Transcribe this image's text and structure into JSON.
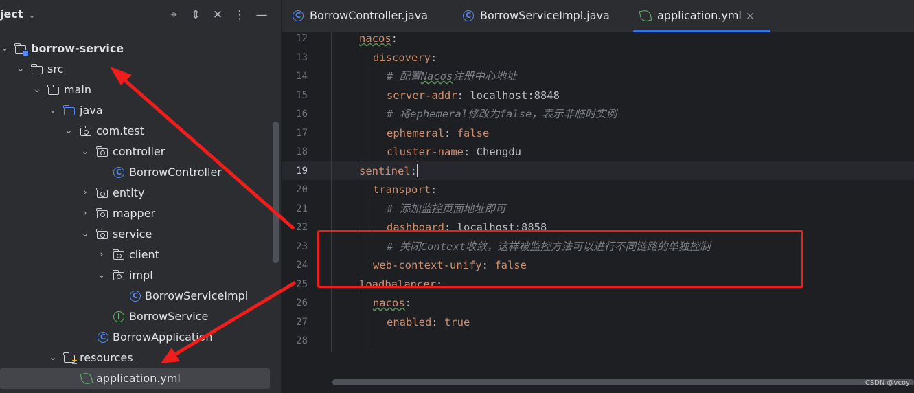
{
  "project_panel": {
    "title": "ject",
    "tree": [
      {
        "label": "borrow-service",
        "icon": "module-folder-icon",
        "expanded": true,
        "bold": true
      },
      {
        "label": "src",
        "icon": "folder-icon",
        "expanded": true
      },
      {
        "label": "main",
        "icon": "folder-icon",
        "expanded": true
      },
      {
        "label": "java",
        "icon": "source-folder-icon",
        "expanded": true
      },
      {
        "label": "com.test",
        "icon": "package-icon",
        "expanded": true
      },
      {
        "label": "controller",
        "icon": "package-icon",
        "expanded": true
      },
      {
        "label": "BorrowController",
        "icon": "class-icon"
      },
      {
        "label": "entity",
        "icon": "package-icon",
        "expanded": false
      },
      {
        "label": "mapper",
        "icon": "package-icon",
        "expanded": false
      },
      {
        "label": "service",
        "icon": "package-icon",
        "expanded": true
      },
      {
        "label": "client",
        "icon": "package-icon",
        "expanded": false
      },
      {
        "label": "impl",
        "icon": "package-icon",
        "expanded": true
      },
      {
        "label": "BorrowServiceImpl",
        "icon": "class-icon"
      },
      {
        "label": "BorrowService",
        "icon": "interface-icon"
      },
      {
        "label": "BorrowApplication",
        "icon": "spring-boot-class-icon"
      },
      {
        "label": "resources",
        "icon": "resources-folder-icon",
        "expanded": true
      },
      {
        "label": "application.yml",
        "icon": "spring-yml-icon",
        "selected": true
      }
    ]
  },
  "tabs": [
    {
      "label": "BorrowController.java",
      "icon": "class-icon"
    },
    {
      "label": "BorrowServiceImpl.java",
      "icon": "class-icon"
    },
    {
      "label": "application.yml",
      "icon": "spring-yml-icon",
      "active": true,
      "close": "×"
    }
  ],
  "editor": {
    "line_numbers": [
      "12",
      "13",
      "14",
      "15",
      "16",
      "17",
      "18",
      "19",
      "20",
      "21",
      "22",
      "23",
      "24",
      "25",
      "26",
      "27",
      "28"
    ],
    "current_line": "19",
    "code": {
      "l12": {
        "key": "nacos",
        "sep": ":"
      },
      "l13": {
        "key": "discovery",
        "sep": ":"
      },
      "l14": {
        "c1": "# 配置",
        "c2": "Nacos",
        "c3": "注册中心地址"
      },
      "l15": {
        "key": "server-addr",
        "sep": ": ",
        "val": "localhost:8848"
      },
      "l16": {
        "text": "# 将ephemeral修改为false，表示非临时实例"
      },
      "l17": {
        "key": "ephemeral",
        "sep": ": ",
        "val": "false"
      },
      "l18": {
        "key": "cluster-name",
        "sep": ": ",
        "val": "Chengdu"
      },
      "l19": {
        "key": "sentinel",
        "sep": ":"
      },
      "l20": {
        "key": "transport",
        "sep": ":"
      },
      "l21": {
        "text": "# 添加监控页面地址即可"
      },
      "l22": {
        "key": "dashboard",
        "sep": ": ",
        "val": "localhost:8858"
      },
      "l23": {
        "text": "# 关闭Context收敛，这样被监控方法可以进行不同链路的单独控制"
      },
      "l24": {
        "key": "web-context-unify",
        "sep": ": ",
        "val": "false"
      },
      "l25": {
        "key": "loadbalancer",
        "sep": ":"
      },
      "l26": {
        "key": "nacos",
        "sep": ":"
      },
      "l27": {
        "key": "enabled",
        "sep": ": ",
        "val": "true"
      }
    }
  },
  "watermark": "CSDN @vcoy",
  "colors": {
    "annotation_red": "#f01d1d",
    "accent_blue": "#3574f0",
    "yaml_key": "#cf8e6d",
    "comment": "#7a7e85"
  }
}
